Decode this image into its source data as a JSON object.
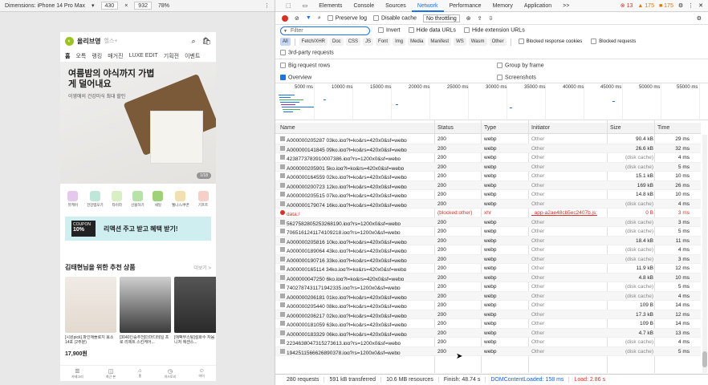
{
  "device_toolbar": {
    "dimensions_label": "Dimensions: iPhone 14 Pro Max",
    "width": "430",
    "times": "×",
    "height": "932",
    "zoom": "78%"
  },
  "phone": {
    "brand": "올리브영",
    "brand_sub": "헬스+",
    "nav": [
      "홈",
      "오특",
      "랭킹",
      "매거진",
      "LUXE EDIT",
      "기획전",
      "이벤트"
    ],
    "banner_title": "여름밤의 야식까지 가볍게 덜어내요",
    "banner_sub": "이영애의 건강미식 최대 할인",
    "banner_page": "1/18",
    "categories": [
      "뷰케어",
      "건강템모기",
      "타이라",
      "선물하기",
      "세일",
      "웰니스/쿠폰",
      "기프트"
    ],
    "coupon_label": "COUPON",
    "coupon_value": "10%",
    "promo_text": "리액션 주고 받고 혜택 받기!",
    "rec_title": "김태현님을 위한 추천 상품",
    "rec_more": "더보기 >",
    "products": [
      {
        "name": "[시원pick] 파인애플로지 효소 14포 (2주분)",
        "price": "17,900원"
      },
      {
        "name": "[3040인증추천]더마디테일 프로 리제트 스킨케어...",
        "price": ""
      },
      {
        "name": "[에팩부스팅]설화수 자음 기고니처 에센스...",
        "price": ""
      }
    ],
    "bottom_nav": [
      "카테고리",
      "최근 본",
      "홈",
      "히스토리",
      "마이"
    ]
  },
  "devtools": {
    "tabs": [
      "Elements",
      "Console",
      "Sources",
      "Network",
      "Performance",
      "Memory",
      "Application",
      ">>"
    ],
    "active_tab": "Network",
    "errors": "13",
    "warnings": "175",
    "issues": "175",
    "toolbar": {
      "preserve_log": "Preserve log",
      "disable_cache": "Disable cache",
      "throttling": "No throttling"
    },
    "filter_placeholder": "Filter",
    "invert": "Invert",
    "hide_data_urls": "Hide data URLs",
    "hide_extension_urls": "Hide extension URLs",
    "types": [
      "All",
      "Fetch/XHR",
      "Doc",
      "CSS",
      "JS",
      "Font",
      "Img",
      "Media",
      "Manifest",
      "WS",
      "Wasm",
      "Other"
    ],
    "blocked_cookies": "Blocked response cookies",
    "blocked_requests": "Blocked requests",
    "third_party": "3rd-party requests",
    "big_rows": "Big request rows",
    "group_by_frame": "Group by frame",
    "overview": "Overview",
    "screenshots": "Screenshots",
    "timeline_ticks": [
      "5000 ms",
      "10000 ms",
      "15000 ms",
      "20000 ms",
      "25000 ms",
      "30000 ms",
      "35000 ms",
      "40000 ms",
      "45000 ms",
      "50000 ms",
      "55000 ms"
    ],
    "columns": [
      "Name",
      "Status",
      "Type",
      "Initiator",
      "Size",
      "Time"
    ],
    "rows": [
      {
        "name": "A000000205287 03ko.jpg?l=ko&rs=420x0&sf=webp",
        "status": "200",
        "type": "webp",
        "initiator": "Other",
        "size": "90.4 kB",
        "time": "29 ms"
      },
      {
        "name": "A000000141845 09ko.jpg?l=ko&rs=420x0&sf=webp",
        "status": "200",
        "type": "webp",
        "initiator": "Other",
        "size": "26.6 kB",
        "time": "32 ms"
      },
      {
        "name": "4238773783910007386.jpg?rs=1200x0&sf=webp",
        "status": "200",
        "type": "webp",
        "initiator": "Other",
        "size": "(disk cache)",
        "time": "4 ms"
      },
      {
        "name": "A000000205901 5ko.jpg?l=ko&rs=420x0&sf=webp",
        "status": "200",
        "type": "webp",
        "initiator": "Other",
        "size": "(disk cache)",
        "time": "5 ms"
      },
      {
        "name": "A000000164559 02ko.jpg?l=ko&rs=420x0&sf=webp",
        "status": "200",
        "type": "webp",
        "initiator": "Other",
        "size": "15.1 kB",
        "time": "10 ms"
      },
      {
        "name": "A000000200723 12ko.jpg?l=ko&rs=420x0&sf=webp",
        "status": "200",
        "type": "webp",
        "initiator": "Other",
        "size": "169 kB",
        "time": "26 ms"
      },
      {
        "name": "A000000205515 07ko.jpg?l=ko&rs=420x0&sf=webp",
        "status": "200",
        "type": "webp",
        "initiator": "Other",
        "size": "14.8 kB",
        "time": "10 ms"
      },
      {
        "name": "A000000179074 16ko.jpg?l=ko&rs=420x0&sf=webp",
        "status": "200",
        "type": "webp",
        "initiator": "Other",
        "size": "(disk cache)",
        "time": "4 ms"
      },
      {
        "name": "data:/",
        "status": "(blocked:other)",
        "type": "xhr",
        "initiator": "_app-a2ae48cb5ec2407b.js:",
        "size": "0 B",
        "time": "3 ms",
        "error": true
      },
      {
        "name": "5627582805253268190.jpg?rs=1200x0&sf=webp",
        "status": "200",
        "type": "webp",
        "initiator": "Other",
        "size": "(disk cache)",
        "time": "3 ms"
      },
      {
        "name": "7065161241174109218.jpg?rs=1200x0&sf=webp",
        "status": "200",
        "type": "webp",
        "initiator": "Other",
        "size": "(disk cache)",
        "time": "5 ms"
      },
      {
        "name": "A000000205816 10ko.jpg?l=ko&rs=420x0&sf=webp",
        "status": "200",
        "type": "webp",
        "initiator": "Other",
        "size": "18.4 kB",
        "time": "11 ms"
      },
      {
        "name": "A000000189064 43ko.jpg?l=ko&rs=420x0&sf=webp",
        "status": "200",
        "type": "webp",
        "initiator": "Other",
        "size": "(disk cache)",
        "time": "4 ms"
      },
      {
        "name": "A000000190716 33ko.jpg?l=ko&rs=420x0&sf=webp",
        "status": "200",
        "type": "webp",
        "initiator": "Other",
        "size": "(disk cache)",
        "time": "3 ms"
      },
      {
        "name": "A000000165114 34ko.jpg?l=ko&rs=420x0&sf=webp",
        "status": "200",
        "type": "webp",
        "initiator": "Other",
        "size": "11.9 kB",
        "time": "12 ms"
      },
      {
        "name": "A000000047250 6ko.jpg?l=ko&rs=420x0&sf=webp",
        "status": "200",
        "type": "webp",
        "initiator": "Other",
        "size": "4.8 kB",
        "time": "10 ms"
      },
      {
        "name": "7402787431171942335.jpg?rs=1200x0&sf=webp",
        "status": "200",
        "type": "webp",
        "initiator": "Other",
        "size": "(disk cache)",
        "time": "5 ms"
      },
      {
        "name": "A000000206181 01ko.jpg?l=ko&rs=420x0&sf=webp",
        "status": "200",
        "type": "webp",
        "initiator": "Other",
        "size": "(disk cache)",
        "time": "4 ms"
      },
      {
        "name": "A000000205440 08ko.jpg?l=ko&rs=420x0&sf=webp",
        "status": "200",
        "type": "webp",
        "initiator": "Other",
        "size": "109 B",
        "time": "14 ms"
      },
      {
        "name": "A000000206217 02ko.jpg?l=ko&rs=420x0&sf=webp",
        "status": "200",
        "type": "webp",
        "initiator": "Other",
        "size": "17.3 kB",
        "time": "12 ms"
      },
      {
        "name": "A000000181059 63ko.jpg?l=ko&rs=420x0&sf=webp",
        "status": "200",
        "type": "webp",
        "initiator": "Other",
        "size": "109 B",
        "time": "14 ms"
      },
      {
        "name": "A000000183329 06ko.jpg?l=ko&rs=420x0&sf=webp",
        "status": "200",
        "type": "webp",
        "initiator": "Other",
        "size": "4.7 kB",
        "time": "13 ms"
      },
      {
        "name": "2234638047315273613.jpg?rs=1200x0&sf=webp",
        "status": "200",
        "type": "webp",
        "initiator": "Other",
        "size": "(disk cache)",
        "time": "4 ms"
      },
      {
        "name": "1942511566626890378.jpg?rs=1200x0&sf=webp",
        "status": "200",
        "type": "webp",
        "initiator": "Other",
        "size": "(disk cache)",
        "time": "5 ms"
      }
    ],
    "status_bar": {
      "requests": "280 requests",
      "transferred": "591 kB transferred",
      "resources": "10.6 MB resources",
      "finish": "Finish: 48.74 s",
      "dcl": "DOMContentLoaded: 158 ms",
      "load": "Load: 2.86 s"
    }
  }
}
